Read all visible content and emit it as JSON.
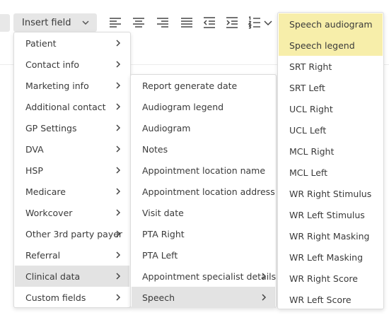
{
  "toolbar": {
    "insert_field_label": "Insert field",
    "icons": [
      "align-left-icon",
      "align-center-icon",
      "align-right-icon",
      "align-justify-icon",
      "outdent-icon",
      "indent-icon",
      "numbered-list-icon",
      "chevron-down-icon"
    ]
  },
  "menu_level1": {
    "items": [
      {
        "label": "Patient"
      },
      {
        "label": "Contact info"
      },
      {
        "label": "Marketing info"
      },
      {
        "label": "Additional contact"
      },
      {
        "label": "GP Settings"
      },
      {
        "label": "DVA"
      },
      {
        "label": "HSP"
      },
      {
        "label": "Medicare"
      },
      {
        "label": "Workcover"
      },
      {
        "label": "Other 3rd party payer"
      },
      {
        "label": "Referral"
      },
      {
        "label": "Clinical data"
      },
      {
        "label": "Custom fields"
      }
    ],
    "active_item": "Clinical data"
  },
  "menu_level2": {
    "items": [
      {
        "label": "Report generate date"
      },
      {
        "label": "Audiogram legend"
      },
      {
        "label": "Audiogram"
      },
      {
        "label": "Notes"
      },
      {
        "label": "Appointment location name"
      },
      {
        "label": "Appointment location address"
      },
      {
        "label": "Visit date"
      },
      {
        "label": "PTA Right"
      },
      {
        "label": "PTA Left"
      },
      {
        "label": "Appointment specialist details"
      },
      {
        "label": "Speech"
      }
    ],
    "active_item": "Speech"
  },
  "menu_level3": {
    "items": [
      {
        "label": "Speech audiogram"
      },
      {
        "label": "Speech legend"
      },
      {
        "label": "SRT Right"
      },
      {
        "label": "SRT Left"
      },
      {
        "label": "UCL Right"
      },
      {
        "label": "UCL Left"
      },
      {
        "label": "MCL Right"
      },
      {
        "label": "MCL Left"
      },
      {
        "label": "WR Right Stimulus"
      },
      {
        "label": "WR Left Stimulus"
      },
      {
        "label": "WR Right Masking"
      },
      {
        "label": "WR Left Masking"
      },
      {
        "label": "WR Right Score"
      },
      {
        "label": "WR Left Score"
      }
    ],
    "highlighted_items": [
      "Speech audiogram",
      "Speech legend"
    ]
  },
  "colors": {
    "active_bg": "#e3e3e3",
    "highlight_bg": "#f7eeaa",
    "button_bg": "#e6e6e6"
  }
}
